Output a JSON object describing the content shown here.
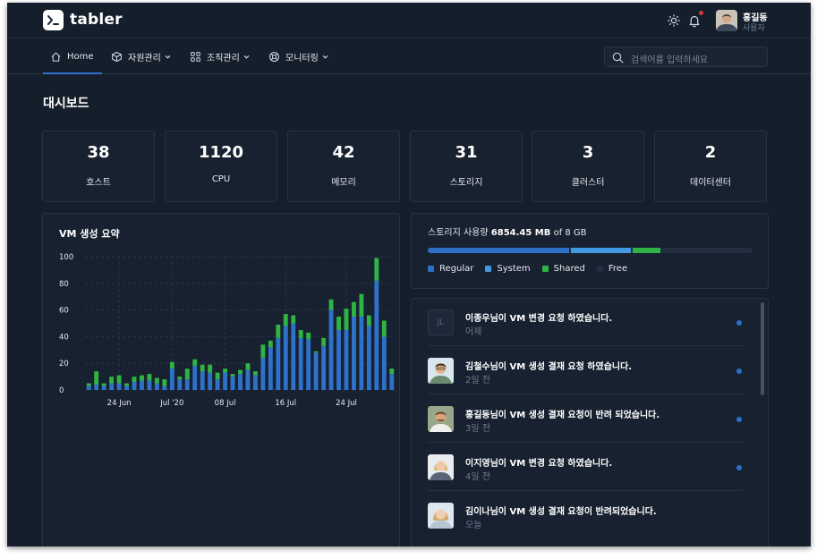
{
  "header": {
    "brand": "tabler",
    "user": {
      "name": "홍길동",
      "role": "사용자"
    }
  },
  "nav": {
    "items": [
      {
        "label": "Home",
        "icon": "home-icon"
      },
      {
        "label": "자원관리",
        "icon": "package-icon"
      },
      {
        "label": "조직관리",
        "icon": "grid-icon"
      },
      {
        "label": "모니터링",
        "icon": "lifebuoy-icon"
      }
    ],
    "search_placeholder": "검색어를 입력하세요"
  },
  "page": {
    "title": "대시보드"
  },
  "stats": [
    {
      "value": "38",
      "label": "호스트"
    },
    {
      "value": "1120",
      "label": "CPU"
    },
    {
      "value": "42",
      "label": "메모리"
    },
    {
      "value": "31",
      "label": "스토리지"
    },
    {
      "value": "3",
      "label": "클러스터"
    },
    {
      "value": "2",
      "label": "데이터센터"
    }
  ],
  "vm_chart": {
    "title": "VM 생성 요약"
  },
  "chart_data": {
    "type": "bar",
    "stacked": true,
    "ylim": [
      0,
      100
    ],
    "yticks": [
      0,
      20,
      40,
      60,
      80,
      100
    ],
    "xtick_labels": [
      "24 Jun",
      "Jul '20",
      "08 Jul",
      "16 Jul",
      "24 Jul"
    ],
    "xtick_index": [
      4,
      11,
      18,
      26,
      34
    ],
    "grid": true,
    "series": [
      {
        "color": "#2f70c9",
        "values": [
          3,
          4,
          3,
          5,
          5,
          3,
          6,
          7,
          7,
          5,
          3,
          16,
          8,
          8,
          18,
          14,
          13,
          8,
          13,
          10,
          12,
          15,
          11,
          24,
          32,
          39,
          48,
          50,
          39,
          38,
          28,
          33,
          60,
          45,
          45,
          55,
          55,
          48,
          82,
          40,
          12
        ]
      },
      {
        "color": "#2fb344",
        "values": [
          2,
          10,
          2,
          5,
          6,
          2,
          4,
          4,
          5,
          4,
          5,
          5,
          2,
          8,
          5,
          5,
          6,
          5,
          3,
          2,
          3,
          5,
          3,
          10,
          5,
          10,
          9,
          6,
          6,
          5,
          1,
          6,
          8,
          10,
          16,
          11,
          17,
          8,
          17,
          12,
          4
        ]
      }
    ],
    "colors": {
      "system": "#4299e1"
    }
  },
  "storage": {
    "title_prefix": "스토리지 사용량",
    "used": "6854.45 MB",
    "total_text": "of 8 GB",
    "segments": [
      {
        "name": "Regular",
        "color": "#2f70c9",
        "percent": 44
      },
      {
        "name": "System",
        "color": "#4299e1",
        "percent": 19
      },
      {
        "name": "Shared",
        "color": "#2fb344",
        "percent": 9
      },
      {
        "name": "Free",
        "color": "#232e40",
        "percent": 28
      }
    ]
  },
  "activities": [
    {
      "avatar": "JL",
      "text": "이종우님이 VM 변경 요청 하였습니다.",
      "time": "어제",
      "unread": true
    },
    {
      "avatar": "",
      "text": "김철수님이 VM 생성 결재 요청 하였습니다.",
      "time": "2일 전",
      "unread": true
    },
    {
      "avatar": "",
      "text": "홍길동님이 VM 생성 결재 요청이 반려 되었습니다.",
      "time": "3일 전",
      "unread": true
    },
    {
      "avatar": "",
      "text": "이지영님이 VM 변경 요청 하였습니다.",
      "time": "4일 전",
      "unread": true
    },
    {
      "avatar": "",
      "text": "김이나님이 VM 생성 결재 요청이 반려되었습니다.",
      "time": "오늘",
      "unread": false
    }
  ]
}
